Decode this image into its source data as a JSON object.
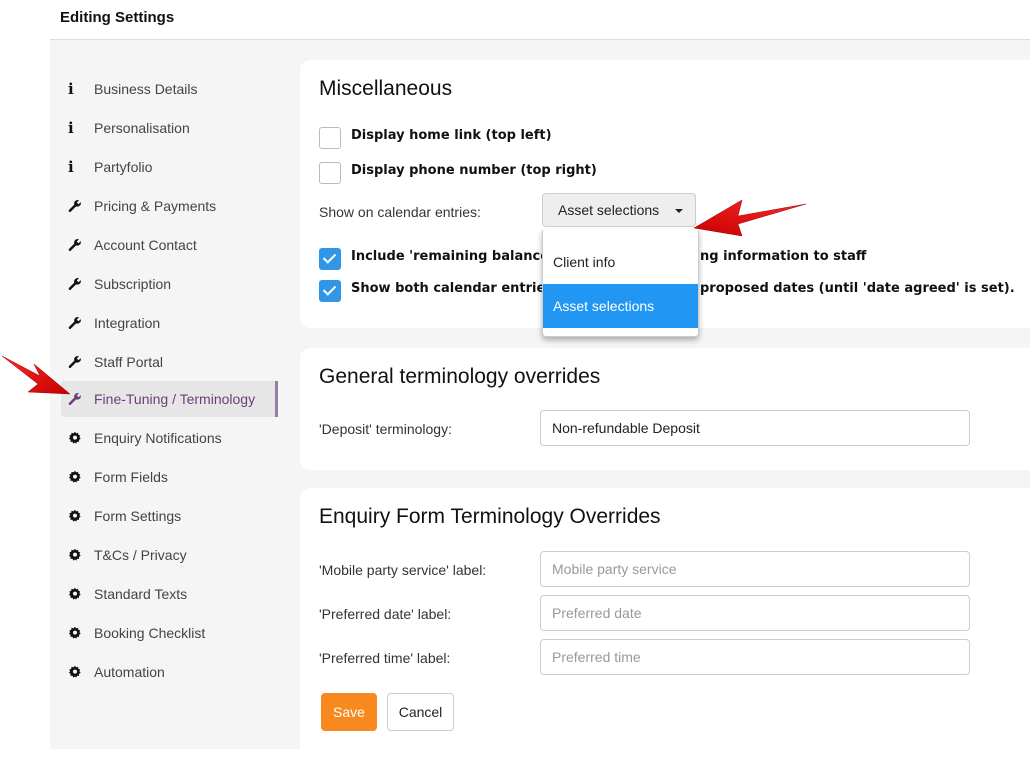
{
  "page": {
    "title": "Editing Settings"
  },
  "sidebar": {
    "items": [
      {
        "label": "Business Details",
        "icon": "info-icon"
      },
      {
        "label": "Personalisation",
        "icon": "info-icon"
      },
      {
        "label": "Partyfolio",
        "icon": "info-icon"
      },
      {
        "label": "Pricing & Payments",
        "icon": "wrench-icon"
      },
      {
        "label": "Account Contact",
        "icon": "wrench-icon"
      },
      {
        "label": "Subscription",
        "icon": "wrench-icon"
      },
      {
        "label": "Integration",
        "icon": "wrench-icon"
      },
      {
        "label": "Staff Portal",
        "icon": "wrench-icon"
      },
      {
        "label": "Fine-Tuning / Terminology",
        "icon": "wrench-icon",
        "active": true
      },
      {
        "label": "Enquiry Notifications",
        "icon": "gear-icon"
      },
      {
        "label": "Form Fields",
        "icon": "gear-icon"
      },
      {
        "label": "Form Settings",
        "icon": "gear-icon"
      },
      {
        "label": "T&Cs / Privacy",
        "icon": "gear-icon"
      },
      {
        "label": "Standard Texts",
        "icon": "gear-icon"
      },
      {
        "label": "Booking Checklist",
        "icon": "gear-icon"
      },
      {
        "label": "Automation",
        "icon": "gear-icon"
      }
    ]
  },
  "misc": {
    "title": "Miscellaneous",
    "home_link": {
      "label": "Display home link (top left)",
      "checked": false
    },
    "phone_number": {
      "label": "Display phone number (top right)",
      "checked": false
    },
    "calendar": {
      "label": "Show on calendar entries:",
      "selected": "Asset selections",
      "options": [
        "Client info",
        "Asset selections"
      ]
    },
    "remaining_balance": {
      "label_visible_start": "Include 'remaining balance'",
      "label_visible_end": "ng information to staff",
      "checked": true
    },
    "both_entries": {
      "label_visible_start": "Show both calendar entries",
      "label_visible_end": "proposed dates (until 'date agreed' is set).",
      "checked": true
    }
  },
  "general": {
    "title": "General terminology overrides",
    "deposit": {
      "label": "'Deposit' terminology:",
      "value": "Non-refundable Deposit"
    }
  },
  "enquiry": {
    "title": "Enquiry Form Terminology Overrides",
    "fields": [
      {
        "label": "'Mobile party service' label:",
        "value": "",
        "placeholder": "Mobile party service"
      },
      {
        "label": "'Preferred date' label:",
        "value": "",
        "placeholder": "Preferred date"
      },
      {
        "label": "'Preferred time' label:",
        "value": "",
        "placeholder": "Preferred time"
      }
    ],
    "save_label": "Save",
    "cancel_label": "Cancel"
  },
  "colors": {
    "accent": "#2196f3",
    "save": "#f7891f",
    "active_nav": "#6b3e7a",
    "arrow": "#e3080d"
  }
}
